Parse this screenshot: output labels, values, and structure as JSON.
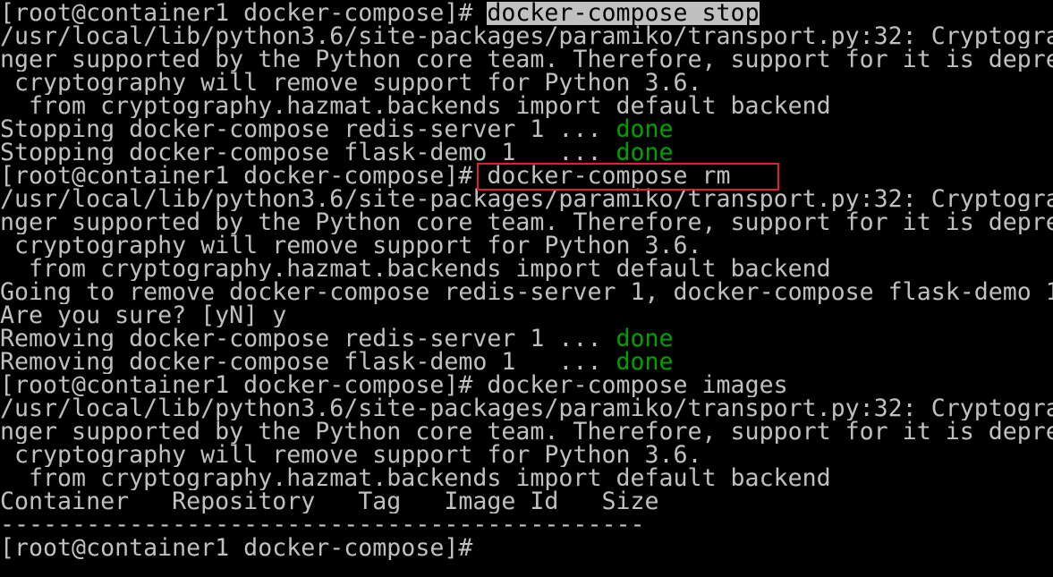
{
  "colors": {
    "background": "#000000",
    "text": "#c0c0c0",
    "done": "#00a000",
    "highlight_border": "#e0202a",
    "selection_bg": "#c0c0c0"
  },
  "prompt": "[root@container1 docker-compose]# ",
  "commands": {
    "stop": "docker-compose stop",
    "rm": "docker-compose rm",
    "images": "docker-compose images"
  },
  "warning": {
    "line1": "/usr/local/lib/python3.6/site-packages/paramiko/transport.py:32: Cryptogra",
    "line2": "nger supported by the Python core team. Therefore, support for it is depre",
    "line3": " cryptography will remove support for Python 3.6.",
    "line4": "  from cryptography.hazmat.backends import default_backend"
  },
  "stop_output": [
    {
      "text": "Stopping docker-compose_redis-server_1 ... ",
      "status": "done"
    },
    {
      "text": "Stopping docker-compose_flask-demo_1   ... ",
      "status": "done"
    }
  ],
  "rm_output": {
    "going": "Going to remove docker-compose_redis-server_1, docker-compose_flask-demo_1",
    "confirm": "Are you sure? [yN] y",
    "removing": [
      {
        "text": "Removing docker-compose_redis-server_1 ... ",
        "status": "done"
      },
      {
        "text": "Removing docker-compose_flask-demo_1   ... ",
        "status": "done"
      }
    ]
  },
  "images_output": {
    "header": "Container   Repository   Tag   Image Id   Size",
    "separator": "---------------------------------------------"
  }
}
